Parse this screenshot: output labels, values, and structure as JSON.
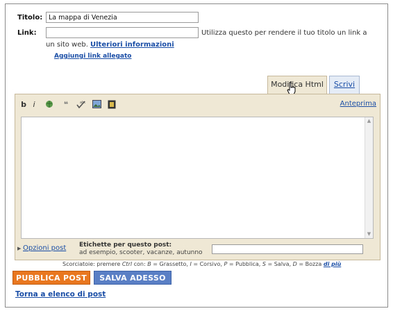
{
  "form": {
    "title_label": "Titolo:",
    "title_value": "La mappa di Venezia",
    "link_label": "Link:",
    "link_value": "",
    "link_hint": "Utilizza questo per rendere il tuo titolo un link a",
    "link_hint_2": "un sito web.",
    "more_info": "Ulteriori informazioni",
    "add_attachment": "Aggiungi link allegato"
  },
  "tabs": {
    "html": "Modifica Html",
    "compose": "Scrivi"
  },
  "toolbar": {
    "bold": "b",
    "italic": "i",
    "preview": "Anteprima"
  },
  "options": {
    "post_options": "Opzioni post",
    "labels_title": "Etichette per questo post:",
    "labels_example": "ad esempio, scooter, vacanze, autunno",
    "labels_value": ""
  },
  "shortcuts": {
    "prefix": "Scorciatoie: premere",
    "ctrl": "Ctrl",
    "con": "con:",
    "b_key": "B",
    "b_text": "= Grassetto,",
    "i_key": "I",
    "i_text": "= Corsivo,",
    "p_key": "P",
    "p_text": "= Pubblica,",
    "s_key": "S",
    "s_text": "= Salva,",
    "d_key": "D",
    "d_text": "= Bozza",
    "more": "di più"
  },
  "actions": {
    "publish": "PUBBLICA POST",
    "save": "SALVA ADESSO",
    "back": "Torna a elenco di post"
  },
  "colors": {
    "publish_bg": "#e8771f",
    "save_bg": "#5b7fc4",
    "link": "#1a4ea6",
    "editor_bg": "#efe8d4"
  }
}
